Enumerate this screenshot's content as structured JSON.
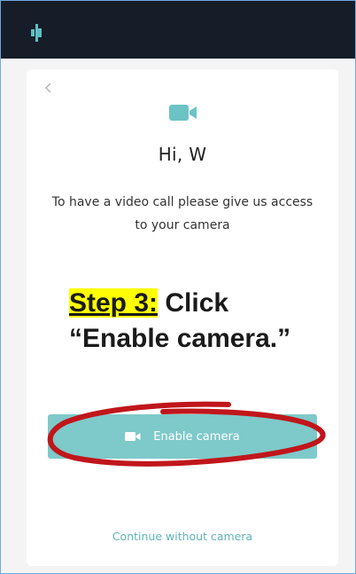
{
  "header": {
    "logo_icon": "brand-logo-icon"
  },
  "card": {
    "back_icon": "chevron-left-icon",
    "camera_icon": "video-camera-icon",
    "greeting": "Hi, W",
    "description": "To have a video call please give us access to your camera",
    "enable_button": {
      "label": "Enable camera",
      "icon": "video-camera-icon"
    },
    "continue_link": "Continue without camera"
  },
  "annotation": {
    "step_label": "Step 3:",
    "instruction_line1": " Click",
    "instruction_line2": "“Enable camera.”"
  },
  "colors": {
    "topbar": "#161c28",
    "accent": "#7ec9c9",
    "highlight": "#ffff00",
    "circle": "#c0161b"
  }
}
